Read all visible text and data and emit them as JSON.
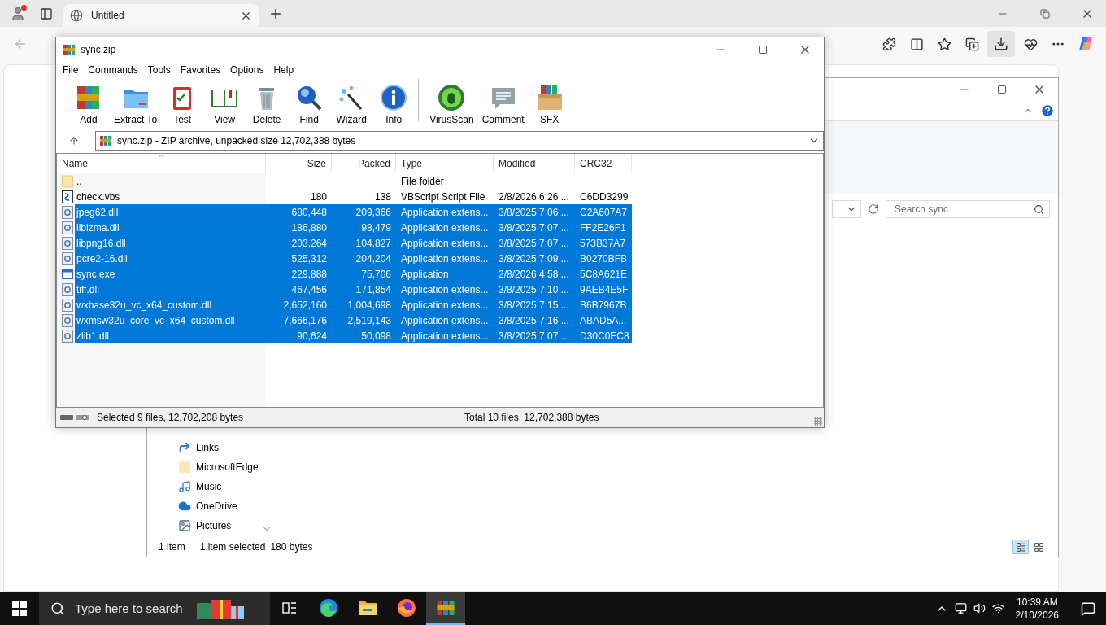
{
  "browser": {
    "tab": {
      "title": "Untitled"
    }
  },
  "explorer": {
    "search": {
      "placeholder": "Search sync"
    },
    "nav_items": [
      {
        "label": "Links",
        "kind": "link"
      },
      {
        "label": "MicrosoftEdge",
        "kind": "folder"
      },
      {
        "label": "Music",
        "kind": "music"
      },
      {
        "label": "OneDrive",
        "kind": "cloud"
      },
      {
        "label": "Pictures",
        "kind": "pictures"
      }
    ],
    "status_bar": {
      "count": "1 item",
      "selection": "1 item selected",
      "size": "180 bytes"
    }
  },
  "winrar": {
    "window": {
      "title": "sync.zip"
    },
    "menu": [
      "File",
      "Commands",
      "Tools",
      "Favorites",
      "Options",
      "Help"
    ],
    "toolbar_groups": [
      {
        "buttons": [
          {
            "label": "Add",
            "kind": "add"
          },
          {
            "label": "Extract To",
            "kind": "extract"
          },
          {
            "label": "Test",
            "kind": "test"
          },
          {
            "label": "View",
            "kind": "view"
          },
          {
            "label": "Delete",
            "kind": "delete"
          },
          {
            "label": "Find",
            "kind": "find"
          },
          {
            "label": "Wizard",
            "kind": "wizard"
          },
          {
            "label": "Info",
            "kind": "info"
          }
        ]
      },
      {
        "buttons": [
          {
            "label": "VirusScan",
            "kind": "virus"
          },
          {
            "label": "Comment",
            "kind": "comment"
          },
          {
            "label": "SFX",
            "kind": "sfx"
          }
        ]
      }
    ],
    "path": "sync.zip - ZIP archive, unpacked size 12,702,388 bytes",
    "table": {
      "columns": [
        {
          "label": "Name",
          "sorted": true
        },
        {
          "label": "Size",
          "sorted": false
        },
        {
          "label": "Packed",
          "sorted": false
        },
        {
          "label": "Type",
          "sorted": false
        },
        {
          "label": "Modified",
          "sorted": false
        },
        {
          "label": "CRC32",
          "sorted": false
        }
      ],
      "rows": [
        {
          "kind": "folder",
          "name": "..",
          "type": "File folder",
          "selected": false
        },
        {
          "kind": "script",
          "name": "check.vbs",
          "size": "180",
          "packed": "138",
          "type": "VBScript Script File",
          "modified": "2/8/2026 6:26 ...",
          "crc": "C6DD3299",
          "selected": false
        },
        {
          "kind": "dll",
          "name": "jpeg62.dll",
          "size": "680,448",
          "packed": "209,366",
          "type": "Application extens...",
          "modified": "3/8/2025 7:06 ...",
          "crc": "C2A607A7",
          "selected": true
        },
        {
          "kind": "dll",
          "name": "liblzma.dll",
          "size": "186,880",
          "packed": "98,479",
          "type": "Application extens...",
          "modified": "3/8/2025 7:07 ...",
          "crc": "FF2E26F1",
          "selected": true
        },
        {
          "kind": "dll",
          "name": "libpng16.dll",
          "size": "203,264",
          "packed": "104,827",
          "type": "Application extens...",
          "modified": "3/8/2025 7:07 ...",
          "crc": "573B37A7",
          "selected": true
        },
        {
          "kind": "dll",
          "name": "pcre2-16.dll",
          "size": "525,312",
          "packed": "204,204",
          "type": "Application extens...",
          "modified": "3/8/2025 7:09 ...",
          "crc": "B0270BFB",
          "selected": true
        },
        {
          "kind": "exe",
          "name": "sync.exe",
          "size": "229,888",
          "packed": "75,706",
          "type": "Application",
          "modified": "2/8/2026 4:58 ...",
          "crc": "5C8A621E",
          "selected": true
        },
        {
          "kind": "dll",
          "name": "tiff.dll",
          "size": "467,456",
          "packed": "171,854",
          "type": "Application extens...",
          "modified": "3/8/2025 7:10 ...",
          "crc": "9AEB4E5F",
          "selected": true
        },
        {
          "kind": "dll",
          "name": "wxbase32u_vc_x64_custom.dll",
          "size": "2,652,160",
          "packed": "1,004,698",
          "type": "Application extens...",
          "modified": "3/8/2025 7:15 ...",
          "crc": "B6B7967B",
          "selected": true
        },
        {
          "kind": "dll",
          "name": "wxmsw32u_core_vc_x64_custom.dll",
          "size": "7,666,176",
          "packed": "2,519,143",
          "type": "Application extens...",
          "modified": "3/8/2025 7:16 ...",
          "crc": "ABAD5A...",
          "selected": true
        },
        {
          "kind": "dll",
          "name": "zlib1.dll",
          "size": "90,624",
          "packed": "50,098",
          "type": "Application extens...",
          "modified": "3/8/2025 7:07 ...",
          "crc": "D30C0EC8",
          "selected": true
        }
      ]
    },
    "status_bar": {
      "selection": "Selected 9 files, 12,702,208 bytes",
      "total": "Total 10 files, 12,702,388 bytes"
    }
  },
  "taskbar": {
    "search": {
      "placeholder": "Type here to search"
    },
    "apps": [
      {
        "kind": "taskview",
        "selected": false
      },
      {
        "kind": "edge",
        "selected": false
      },
      {
        "kind": "files",
        "selected": false
      },
      {
        "kind": "firefox",
        "selected": false
      },
      {
        "kind": "winrar",
        "selected": true
      }
    ],
    "time": "10:39 AM",
    "date": "2/10/2026"
  }
}
